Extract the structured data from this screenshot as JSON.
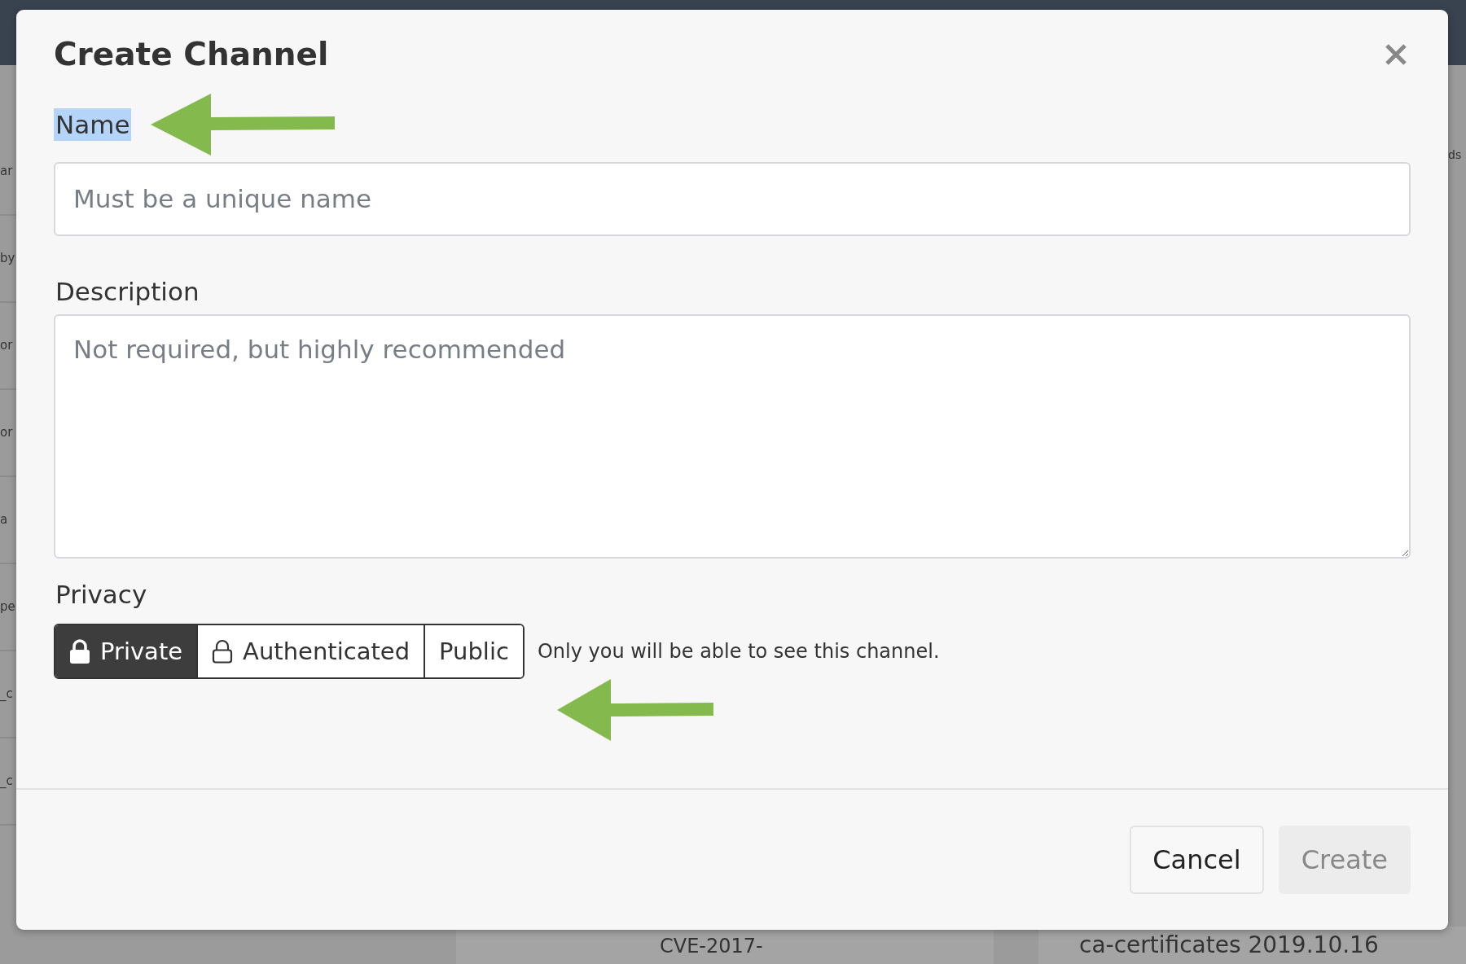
{
  "background": {
    "left_fragments": [
      "ar",
      "by",
      "or",
      "or",
      "a",
      "pe",
      "_c",
      "_c"
    ],
    "right_fragments": [
      "ds"
    ],
    "bottom_texts": [
      "CVE-2017-",
      "ca-certificates 2019.10.16"
    ]
  },
  "dialog": {
    "title": "Create Channel",
    "fields": [
      {
        "kind": "input",
        "label": "Name",
        "label_highlighted": true,
        "placeholder": "Must be a unique name"
      },
      {
        "kind": "textarea",
        "label": "Description",
        "label_highlighted": false,
        "placeholder": "Not required, but highly recommended"
      }
    ],
    "privacy": {
      "label": "Privacy",
      "options": [
        {
          "kind": "filled-lock",
          "label": "Private",
          "selected": true
        },
        {
          "kind": "outline-lock",
          "label": "Authenticated",
          "selected": false
        },
        {
          "kind": "plain",
          "label": "Public",
          "selected": false
        }
      ],
      "help": "Only you will be able to see this channel."
    },
    "buttons": [
      {
        "label": "Cancel",
        "disabled": false
      },
      {
        "label": "Create",
        "disabled": true
      }
    ]
  }
}
